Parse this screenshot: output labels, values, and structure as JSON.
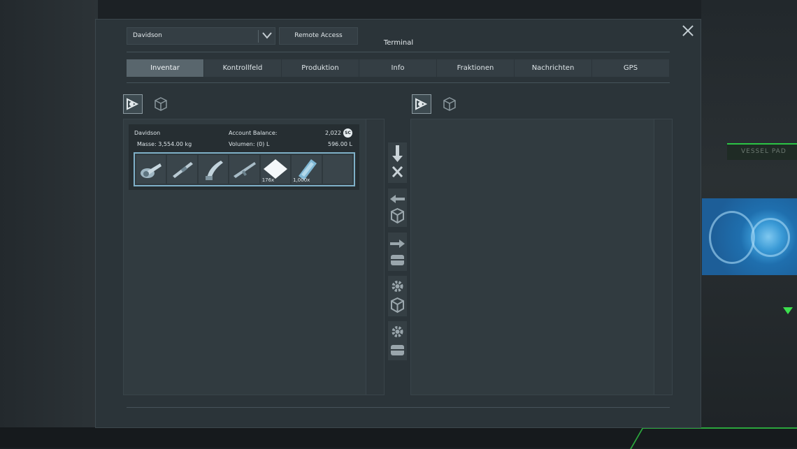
{
  "window": {
    "title": "Terminal",
    "owner_dropdown": {
      "selected": "Davidson"
    },
    "remote_access_label": "Remote Access"
  },
  "tabs": [
    {
      "label": "Inventar",
      "active": true
    },
    {
      "label": "Kontrollfeld"
    },
    {
      "label": "Produktion"
    },
    {
      "label": "Info"
    },
    {
      "label": "Fraktionen"
    },
    {
      "label": "Nachrichten"
    },
    {
      "label": "GPS"
    }
  ],
  "left_inventory": {
    "name": "Davidson",
    "balance_label": "Account Balance:",
    "balance_value": "2,022",
    "currency_icon": "SC",
    "mass_label": "Masse: 3,554.00 kg",
    "volume_label": "Volumen: (0) L",
    "volume_value": "596.00 L",
    "slots": [
      {
        "icon": "grinder-icon",
        "count": ""
      },
      {
        "icon": "welder-icon",
        "count": ""
      },
      {
        "icon": "drill-icon",
        "count": ""
      },
      {
        "icon": "rifle-icon",
        "count": ""
      },
      {
        "icon": "ice-icon",
        "count": "176x"
      },
      {
        "icon": "ore-icon",
        "count": "1,000x"
      },
      {
        "icon": "empty-slot",
        "count": ""
      }
    ]
  },
  "background_sign": "VESSEL PAD",
  "colors": {
    "accent_slot_border": "#7fb0c8",
    "active_tab": "#59666d",
    "panel_bg": "#2b3439",
    "green_light": "#35e24b",
    "screen_blue": "#3a9ad6"
  }
}
